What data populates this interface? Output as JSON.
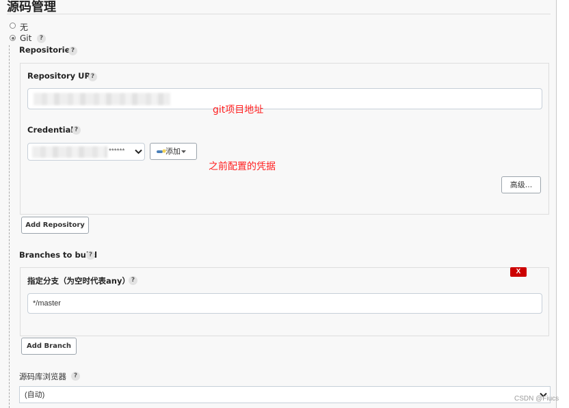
{
  "section": {
    "title": "源码管理"
  },
  "scm_options": [
    {
      "label": "无",
      "selected": false
    },
    {
      "label": "Git",
      "selected": true
    }
  ],
  "repositories": {
    "label": "Repositories",
    "url_label": "Repository URL",
    "url_value": "",
    "credentials_label": "Credentials",
    "credentials_value": "******",
    "add_credentials_label": "添加",
    "advanced_label": "高级...",
    "add_repository_label": "Add Repository"
  },
  "branches": {
    "label": "Branches to build",
    "branch_spec_label": "指定分支（为空时代表any）",
    "branch_spec_value": "*/master",
    "remove_label": "X",
    "add_branch_label": "Add Branch"
  },
  "repo_browser": {
    "label": "源码库浏览器",
    "selected": "(自动)"
  },
  "annotations": {
    "url_note": "git项目地址",
    "credentials_note": "之前配置的凭据"
  },
  "help_glyph": "?",
  "watermark": "CSDN @Fiucs",
  "colors": {
    "annotation": "#ff2020",
    "remove_button": "#cc0000"
  }
}
